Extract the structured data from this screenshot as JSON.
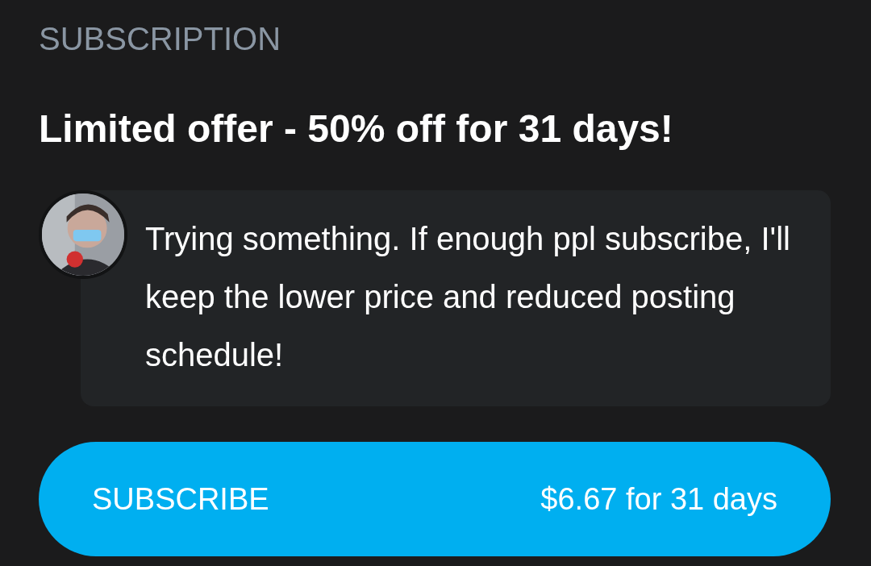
{
  "section_title": "SUBSCRIPTION",
  "offer_title": "Limited offer - 50% off for 31 days!",
  "message": {
    "text": "Trying something. If enough ppl subscribe, I'll keep the lower price and reduced posting schedule!"
  },
  "subscribe_button": {
    "label": "SUBSCRIBE",
    "price": "$6.67 for 31 days"
  }
}
